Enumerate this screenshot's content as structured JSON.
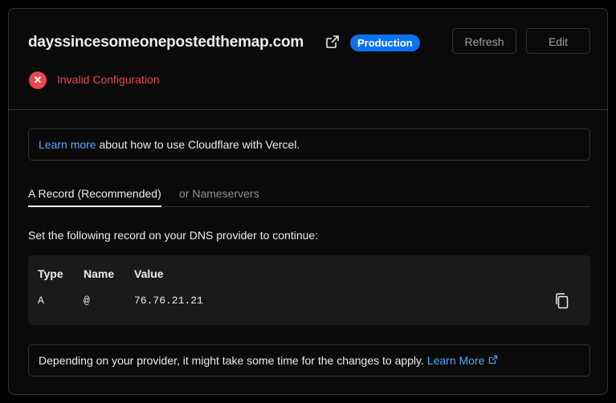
{
  "header": {
    "domain": "dayssincesomeonepostedthemap.com",
    "badge": "Production",
    "refresh_label": "Refresh",
    "edit_label": "Edit",
    "status_text": "Invalid Configuration",
    "status_icon": "error-x-icon"
  },
  "info": {
    "link_text": "Learn more",
    "text": " about how to use Cloudflare with Vercel."
  },
  "tabs": [
    {
      "label": "A Record (Recommended)",
      "active": true
    },
    {
      "label": "or Nameservers",
      "active": false
    }
  ],
  "instructions": "Set the following record on your DNS provider to continue:",
  "record": {
    "headers": [
      "Type",
      "Name",
      "Value"
    ],
    "values": [
      "A",
      "@",
      "76.76.21.21"
    ]
  },
  "note": {
    "text": "Depending on your provider, it might take some time for the changes to apply. ",
    "link_text": "Learn More"
  },
  "colors": {
    "accent": "#0a72ef",
    "link": "#52a8ff",
    "error": "#e5484d"
  }
}
